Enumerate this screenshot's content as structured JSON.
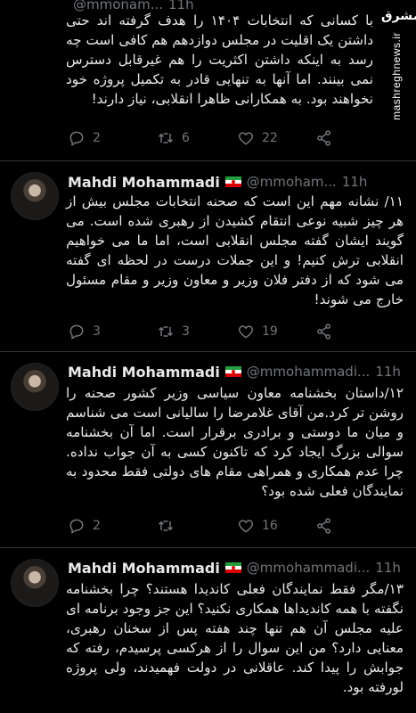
{
  "watermark": {
    "logo_text": "مشرق",
    "site": "mashreghnews.ir"
  },
  "tweets": [
    {
      "author": "",
      "handle": "@mmonam...",
      "time": "11h",
      "text": "با کسانی که انتخابات ۱۴۰۴ را هدف گرفته اند حتی داشتن یک اقلیت در مجلس دوازدهم هم کافی است چه رسد به اینکه داشتن اکثریت را هم غیرقابل دسترس نمی بینند. اما آنها به تنهایی قادر به تکمیل پروژه خود نخواهند بود. به همکارانی ظاهرا انقلابی، نیاز دارند!",
      "replies": "2",
      "retweets": "6",
      "likes": "22"
    },
    {
      "author": "Mahdi Mohammadi",
      "handle": "@mmoham...",
      "time": "11h",
      "text": "۱۱/ نشانه مهم این است که صحنه انتخابات مجلس بیش از هر چیز شبیه نوعی انتقام کشیدن از رهبری شده است. می گویند ایشان گفته مجلس انقلابی است، اما ما می خواهیم انقلابی ترش کنیم! و این جملات درست در لحظه ای گفته می شود که از دفتر فلان وزیر و معاون وزیر و مقام مسئول خارج می شوند!",
      "replies": "3",
      "retweets": "3",
      "likes": "19"
    },
    {
      "author": "Mahdi Mohammadi",
      "handle": "@mmohammadi...",
      "time": "11h",
      "text": "۱۲/داستان بخشنامه معاون سیاسی وزیر کشور صحنه را روشن تر کرد.من آقای غلامرضا را سالیانی است می شناسم و میان ما دوستی و برادری برقرار است. اما آن بخشنامه سوالی بزرگ ایجاد کرد که تاکنون کسی به آن جواب نداده. چرا عدم همکاری و همراهی مقام های دولتی فقط محدود به نمایندگان فعلی شده بود؟",
      "replies": "2",
      "retweets": "",
      "likes": "16"
    },
    {
      "author": "Mahdi Mohammadi",
      "handle": "@mmohammadi...",
      "time": "11h",
      "text": "۱۳/مگر فقط نمایندگان فعلی کاندیدا هستند؟ چرا بخشنامه نگفته با همه کاندیداها همکاری نکنید؟ این جز وجود برنامه ای علیه مجلس آن هم تنها چند هفته پس از سخنان رهبری، معنایی دارد؟ من این سوال را از هرکسی پرسیدم، رفته که جوابش را پیدا کند. عاقلانی در دولت فهمیدند، ولی پروژه لورفته بود.",
      "replies": "",
      "retweets": "",
      "likes": ""
    }
  ]
}
